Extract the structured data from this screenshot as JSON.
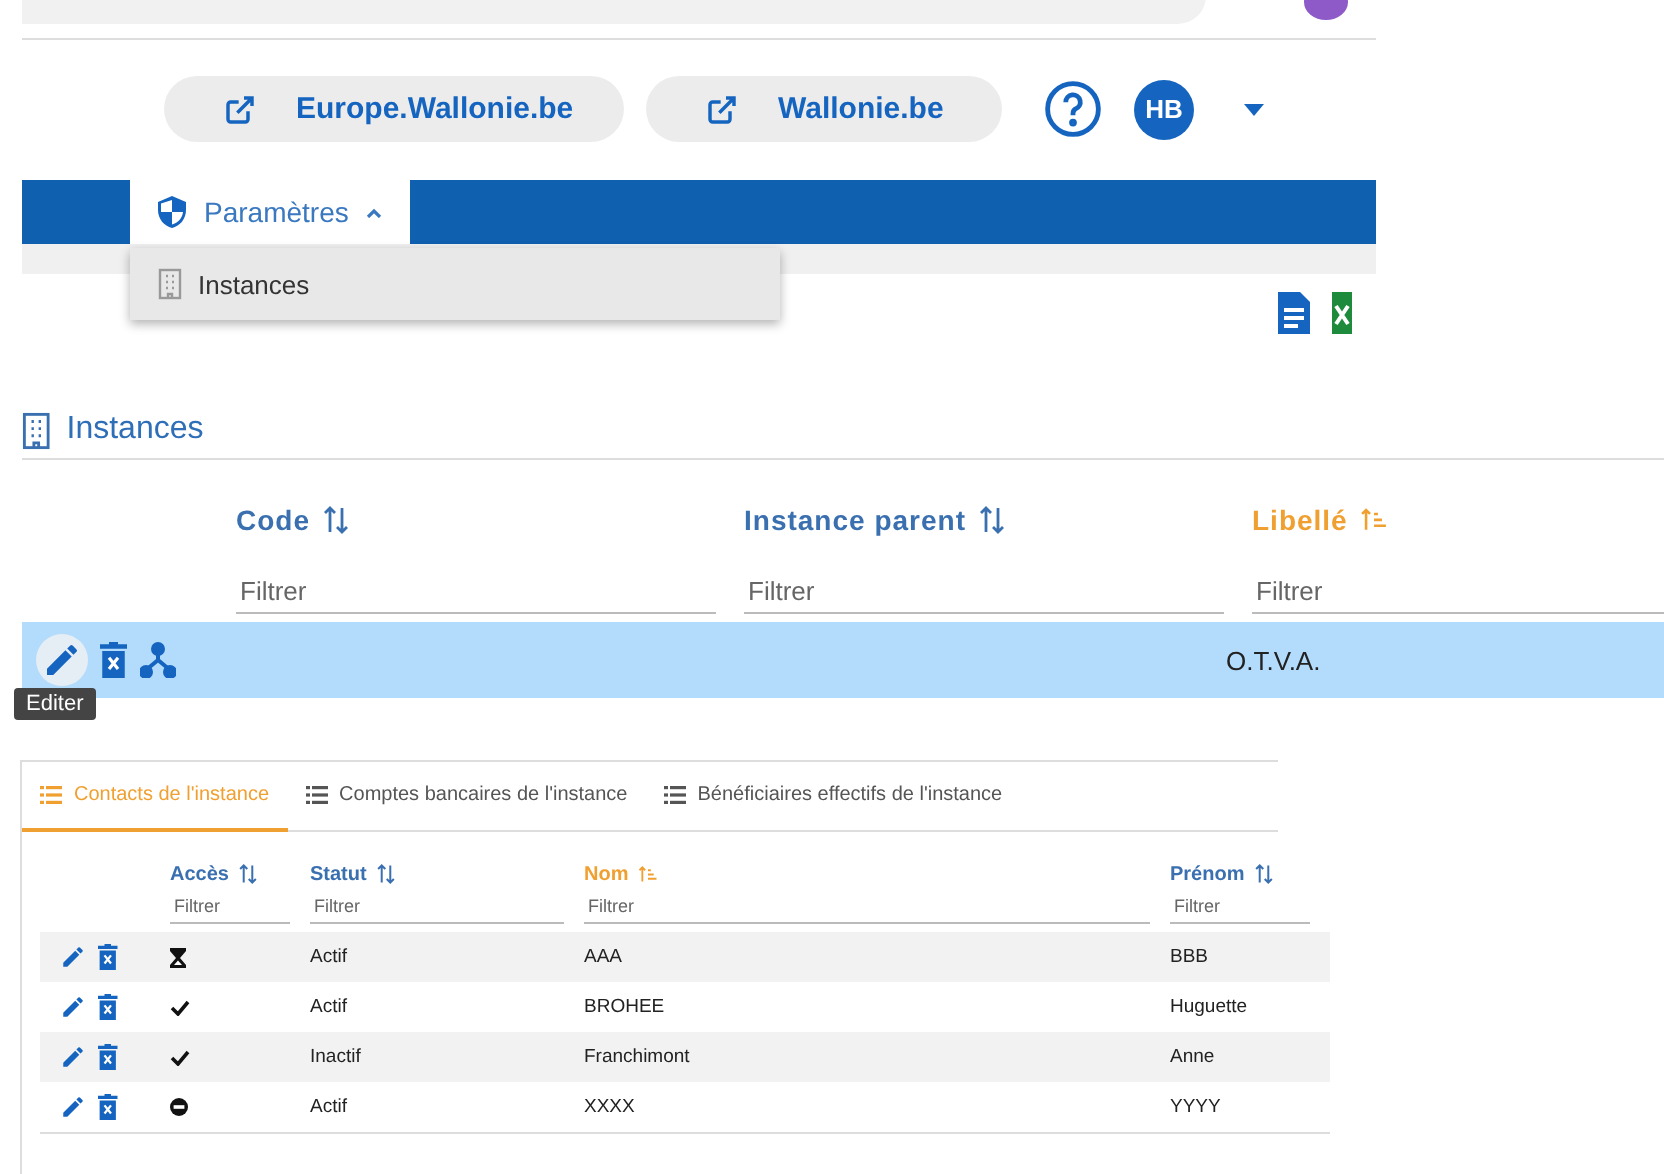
{
  "header": {
    "links": [
      {
        "label": "Europe.Wallonie.be"
      },
      {
        "label": "Wallonie.be"
      }
    ],
    "avatar": "HB"
  },
  "nav": {
    "tabs": [
      {
        "label": "Paramètres",
        "expanded": true
      }
    ],
    "menu": [
      {
        "label": "Instances"
      }
    ]
  },
  "instances": {
    "title": "Instances",
    "columns": [
      {
        "label": "Code",
        "sorted": false,
        "placeholder": "Filtrer"
      },
      {
        "label": "Instance parent",
        "sorted": false,
        "placeholder": "Filtrer"
      },
      {
        "label": "Libellé",
        "sorted": true,
        "placeholder": "Filtrer"
      }
    ],
    "rows": [
      {
        "selected": true,
        "cells": [
          "",
          "",
          "O.T.V.A."
        ]
      }
    ],
    "tooltip": "Editer"
  },
  "details": {
    "tabs": [
      {
        "label": "Contacts de l'instance",
        "selected": true
      },
      {
        "label": "Comptes bancaires de l'instance",
        "selected": false
      },
      {
        "label": "Bénéficiaires effectifs de l'instance",
        "selected": false
      }
    ],
    "columns": [
      {
        "label": "Accès",
        "sorted": false,
        "placeholder": "Filtrer"
      },
      {
        "label": "Statut",
        "sorted": false,
        "placeholder": "Filtrer"
      },
      {
        "label": "Nom",
        "sorted": true,
        "placeholder": "Filtrer"
      },
      {
        "label": "Prénom",
        "sorted": false,
        "placeholder": "Filtrer"
      }
    ],
    "rows": [
      {
        "kind": "pending",
        "statut": "Actif",
        "nom": "AAA",
        "prenom": "BBB"
      },
      {
        "kind": "granted",
        "statut": "Actif",
        "nom": "BROHEE",
        "prenom": "Huguette"
      },
      {
        "kind": "granted",
        "statut": "Inactif",
        "nom": "Franchimont",
        "prenom": "Anne"
      },
      {
        "kind": "blocked",
        "statut": "Actif",
        "nom": "XXXX",
        "prenom": "YYYY"
      }
    ]
  }
}
